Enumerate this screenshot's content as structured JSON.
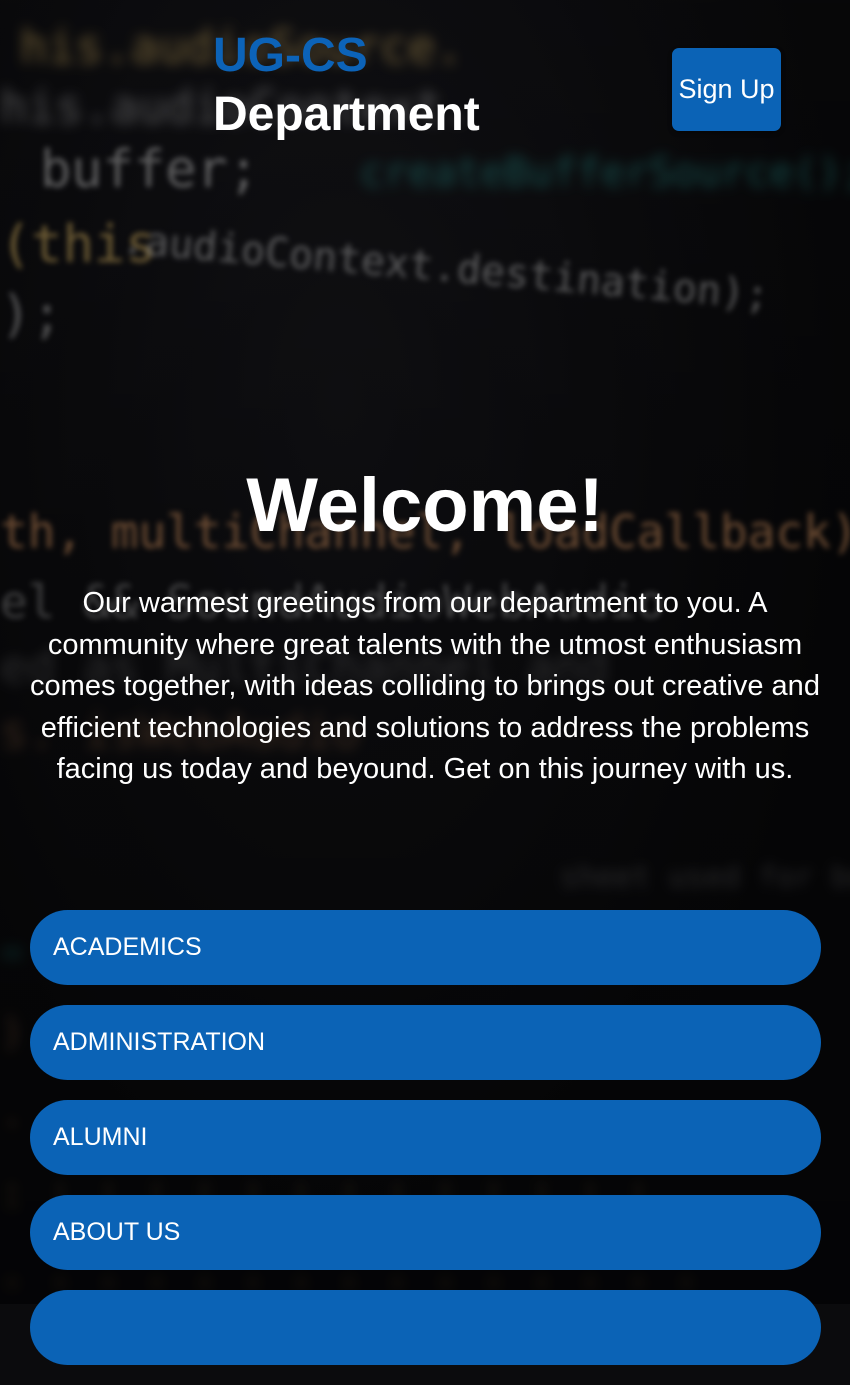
{
  "brand": {
    "line1": "UG-CS",
    "line2": "Department"
  },
  "header": {
    "signup_label": "Sign Up"
  },
  "hero": {
    "title": "Welcome!",
    "text": "Our warmest greetings from our department to you. A community where great talents with the utmost enthusiasm comes together, with ideas colliding to brings out creative and efficient technologies and solutions to address the problems facing us today and beyound. Get on this journey with us."
  },
  "nav": {
    "items": [
      {
        "label": "ACADEMICS"
      },
      {
        "label": "ADMINISTRATION"
      },
      {
        "label": "ALUMNI"
      },
      {
        "label": "ABOUT US"
      },
      {
        "label": ""
      }
    ]
  },
  "colors": {
    "accent": "#0b63b6",
    "brand_blue": "#0c63b8",
    "background": "#0b0b0d"
  }
}
